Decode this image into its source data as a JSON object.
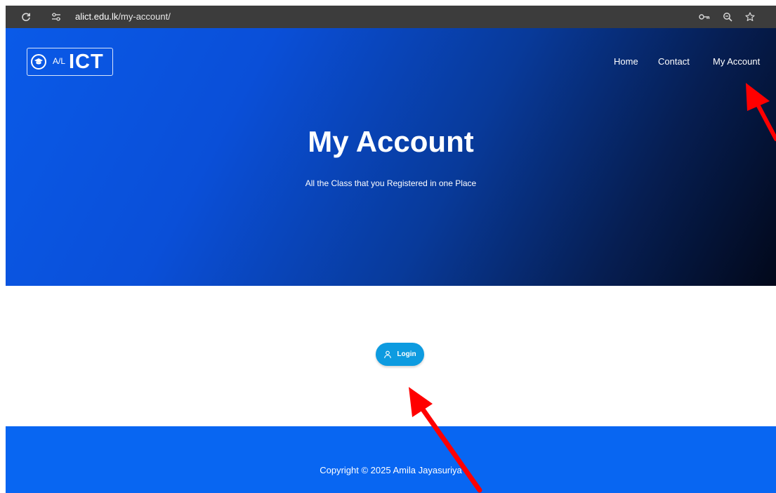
{
  "browser": {
    "url_host": "alict.edu.lk",
    "url_path": "/my-account/"
  },
  "logo": {
    "prefix": "A/L",
    "name": "ICT"
  },
  "nav": {
    "items": [
      "Home",
      "Contact",
      "My Account"
    ]
  },
  "hero": {
    "title": "My Account",
    "subtitle": "All the Class that you Registered in one Place"
  },
  "login_button": {
    "label": "Login",
    "icon": "user-icon"
  },
  "footer": {
    "copyright": "Copyright © 2025 Amila Jayasuriya"
  },
  "colors": {
    "hero_start": "#0a5ae8",
    "hero_end": "#02081a",
    "button": "#0d9be0",
    "footer": "#0866f2",
    "annotation_arrow": "#ff0000"
  }
}
